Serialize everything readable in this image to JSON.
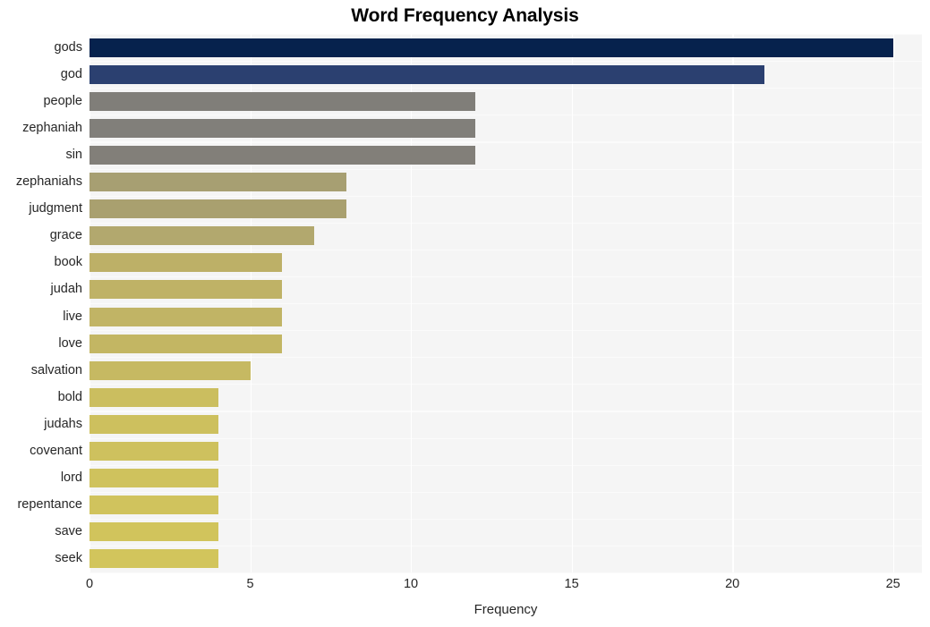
{
  "chart": {
    "title": "Word Frequency Analysis",
    "xlabel": "Frequency",
    "ylabel": ""
  },
  "chart_data": {
    "type": "bar",
    "orientation": "horizontal",
    "title": "Word Frequency Analysis",
    "xlabel": "Frequency",
    "ylabel": "",
    "xlim": [
      0,
      25.9
    ],
    "xticks": [
      0,
      5,
      10,
      15,
      20,
      25
    ],
    "xticklabels": [
      "0",
      "5",
      "10",
      "15",
      "20",
      "25"
    ],
    "grid": true,
    "legend": "none",
    "categories": [
      "gods",
      "god",
      "people",
      "zephaniah",
      "sin",
      "zephaniahs",
      "judgment",
      "grace",
      "book",
      "judah",
      "live",
      "love",
      "salvation",
      "bold",
      "judahs",
      "covenant",
      "lord",
      "repentance",
      "save",
      "seek"
    ],
    "values": [
      25,
      21,
      12,
      12,
      12,
      8,
      8,
      7,
      6,
      6,
      6,
      6,
      5,
      4,
      4,
      4,
      4,
      4,
      4,
      4
    ],
    "colors": [
      "#06224d",
      "#2b4070",
      "#807e79",
      "#817f7a",
      "#827f79",
      "#a79f72",
      "#a9a06f",
      "#b2a86e",
      "#bdb067",
      "#bfb266",
      "#c1b465",
      "#c3b663",
      "#c6b962",
      "#cbbe5f",
      "#cdc05e",
      "#cec15e",
      "#cfc25d",
      "#d0c35d",
      "#d1c45c",
      "#d2c55c"
    ]
  }
}
